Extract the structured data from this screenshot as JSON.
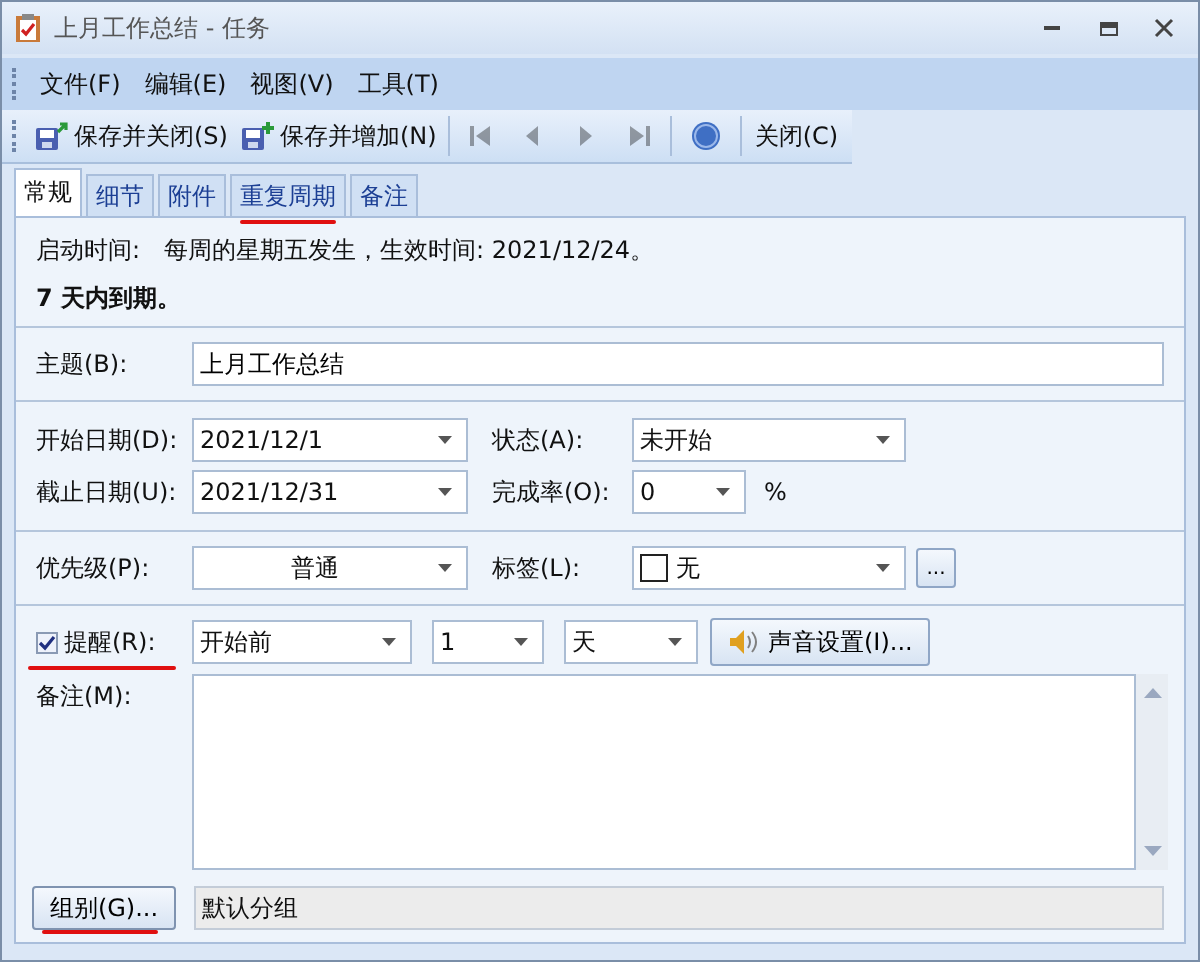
{
  "window": {
    "title": "上月工作总结 - 任务"
  },
  "menu": [
    "文件(F)",
    "编辑(E)",
    "视图(V)",
    "工具(T)"
  ],
  "toolbar": [
    {
      "kind": "save",
      "label": "保存并关闭(S)"
    },
    {
      "kind": "save-new",
      "label": "保存并增加(N)"
    },
    {
      "kind": "separator"
    },
    {
      "kind": "first",
      "disabled": true
    },
    {
      "kind": "prev",
      "disabled": true
    },
    {
      "kind": "next",
      "disabled": true
    },
    {
      "kind": "last",
      "disabled": true
    },
    {
      "kind": "separator"
    },
    {
      "kind": "help"
    },
    {
      "kind": "separator"
    },
    {
      "kind": "text",
      "label": "关闭(C)"
    }
  ],
  "tabs": [
    {
      "label": "常规",
      "selected": true,
      "marked": false
    },
    {
      "label": "细节",
      "selected": false,
      "marked": false
    },
    {
      "label": "附件",
      "selected": false,
      "marked": false
    },
    {
      "label": "重复周期",
      "selected": false,
      "marked": true
    },
    {
      "label": "备注",
      "selected": false,
      "marked": false
    }
  ],
  "info": {
    "start_label": "启动时间:",
    "start_text": "每周的星期五发生，生效时间: 2021/12/24。",
    "due_text": "7 天内到期。"
  },
  "subject": {
    "label": "主题(B):",
    "value": "上月工作总结"
  },
  "start_date": {
    "label": "开始日期(D):",
    "value": "2021/12/1"
  },
  "status": {
    "label": "状态(A):",
    "value": "未开始"
  },
  "due_date": {
    "label": "截止日期(U):",
    "value": "2021/12/31"
  },
  "complete": {
    "label": "完成率(O):",
    "value": "0",
    "unit": "%"
  },
  "priority": {
    "label": "优先级(P):",
    "value": "普通"
  },
  "tag": {
    "label": "标签(L):",
    "value": "无",
    "more": "..."
  },
  "reminder": {
    "label": "提醒(R):",
    "checked": true,
    "marked": true,
    "when": "开始前",
    "amount": "1",
    "unit": "天",
    "sound_button": "声音设置(I)..."
  },
  "notes": {
    "label": "备注(M):"
  },
  "group": {
    "button": "组别(G)...",
    "marked": true,
    "value": "默认分组"
  }
}
